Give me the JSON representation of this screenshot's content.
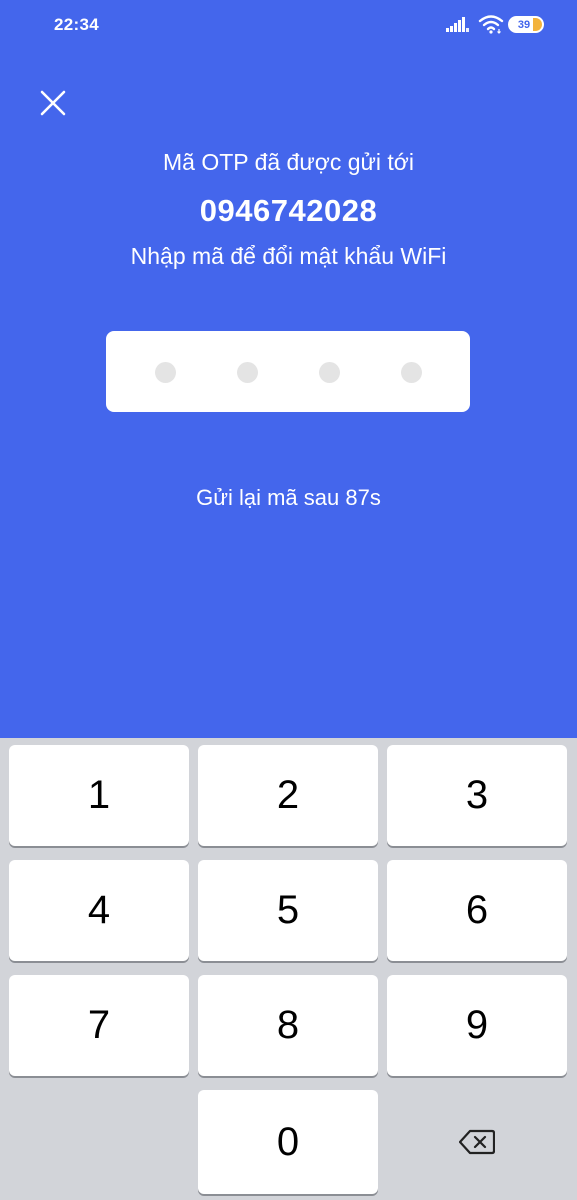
{
  "status_bar": {
    "time": "22:34",
    "battery_level": "39",
    "icons": [
      "signal-icon",
      "wifi-icon",
      "battery-icon"
    ]
  },
  "header": {
    "close_icon": "close-icon",
    "sent_to_label": "Mã OTP đã được gửi tới",
    "phone_number": "0946742028",
    "instruction": "Nhập mã để đổi mật khẩu WiFi"
  },
  "otp": {
    "length": 4,
    "entered": 0
  },
  "resend": {
    "text": "Gửi lại mã sau 87s"
  },
  "keypad": {
    "keys": [
      "1",
      "2",
      "3",
      "4",
      "5",
      "6",
      "7",
      "8",
      "9",
      "0"
    ],
    "backspace_icon": "backspace-icon"
  },
  "colors": {
    "primary": "#4466ec",
    "keypad_bg": "#d2d4d9",
    "key_bg": "#ffffff",
    "otp_dot": "#e4e4e4",
    "battery_fill": "#f3b33b"
  }
}
